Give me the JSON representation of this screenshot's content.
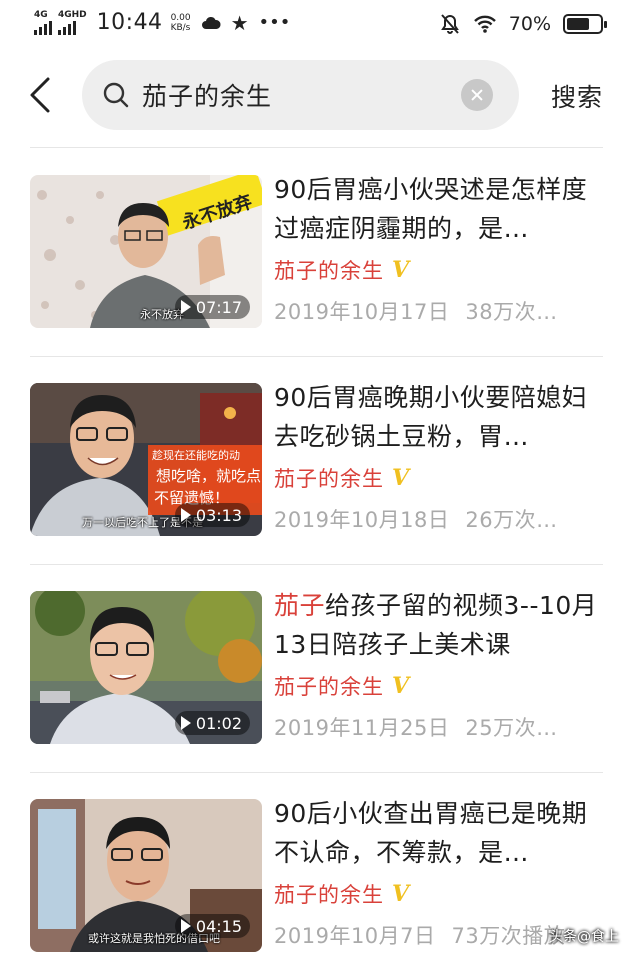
{
  "status_bar": {
    "net1": "4G",
    "net2": "4GHD",
    "time": "10:44",
    "speed_value": "0.00",
    "speed_unit": "KB/s",
    "battery": "70%",
    "battery_level": 0.7
  },
  "search": {
    "query": "茄子的余生",
    "button_label": "搜索"
  },
  "results": [
    {
      "title_highlight": "",
      "title_rest": "90后胃癌小伙哭述是怎样度过癌症阴霾期的，是…",
      "author": "茄子的余生",
      "date": "2019年10月17日",
      "views": "38万次…",
      "duration": "07:17",
      "thumb_caption": "永不放弃",
      "thumb_banner": "永不放弃"
    },
    {
      "title_highlight": "",
      "title_rest": "90后胃癌晚期小伙要陪媳妇去吃砂锅土豆粉，胃…",
      "author": "茄子的余生",
      "date": "2019年10月18日",
      "views": "26万次…",
      "duration": "03:13",
      "thumb_caption": "万一以后吃不上了是不是",
      "thumb_banner_1": "趁现在还能吃的动",
      "thumb_banner_2": "想吃啥，就吃点",
      "thumb_banner_3": "不留遗憾！"
    },
    {
      "title_highlight": "茄子",
      "title_rest": "给孩子留的视频3--10月13日陪孩子上美术课",
      "author": "茄子的余生",
      "date": "2019年11月25日",
      "views": "25万次…",
      "duration": "01:02"
    },
    {
      "title_highlight": "",
      "title_rest": "90后小伙查出胃癌已是晚期不认命，不筹款，是…",
      "author": "茄子的余生",
      "date": "2019年10月7日",
      "views": "73万次播放",
      "duration": "04:15",
      "thumb_caption": "或许这就是我怕死的借口吧"
    }
  ],
  "watermark": "头条@食上",
  "colors": {
    "highlight": "#d9413a",
    "verified": "#f0c020",
    "meta": "#aaaaaa"
  }
}
